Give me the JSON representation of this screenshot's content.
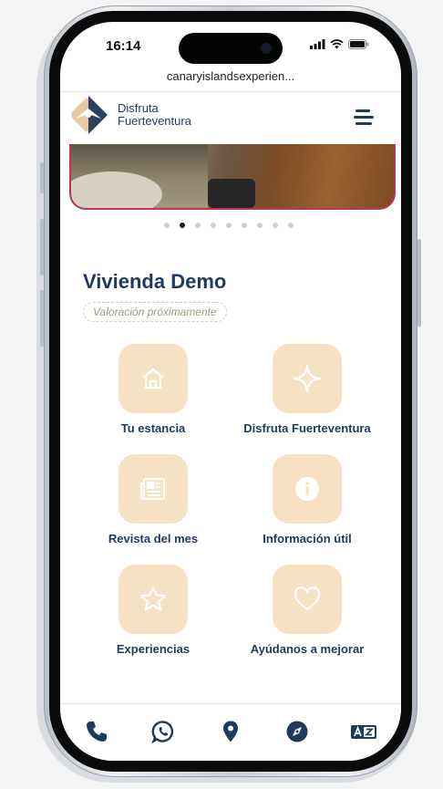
{
  "status_bar": {
    "time": "16:14"
  },
  "browser": {
    "url": "canaryislandsexperien..."
  },
  "header": {
    "brand_line1": "Disfruta",
    "brand_line2": "Fuerteventura"
  },
  "carousel": {
    "slide_count": 9,
    "active_index": 1
  },
  "property": {
    "name": "Vivienda Demo",
    "rating_text": "Valoración próximamente"
  },
  "tiles": [
    {
      "label": "Tu estancia",
      "icon": "house-icon"
    },
    {
      "label": "Disfruta Fuerteventura",
      "icon": "sparkle-icon"
    },
    {
      "label": "Revista del mes",
      "icon": "newspaper-icon"
    },
    {
      "label": "Información útil",
      "icon": "info-icon"
    },
    {
      "label": "Experiencias",
      "icon": "star-icon"
    },
    {
      "label": "Ayúdanos a mejorar",
      "icon": "heart-icon"
    }
  ],
  "bottom_nav": [
    "phone-icon",
    "whatsapp-icon",
    "location-pin-icon",
    "compass-icon",
    "translate-icon"
  ],
  "colors": {
    "primary": "#1f3a5c",
    "tile_bg": "#f6e2c3",
    "accent": "#b8365a"
  }
}
